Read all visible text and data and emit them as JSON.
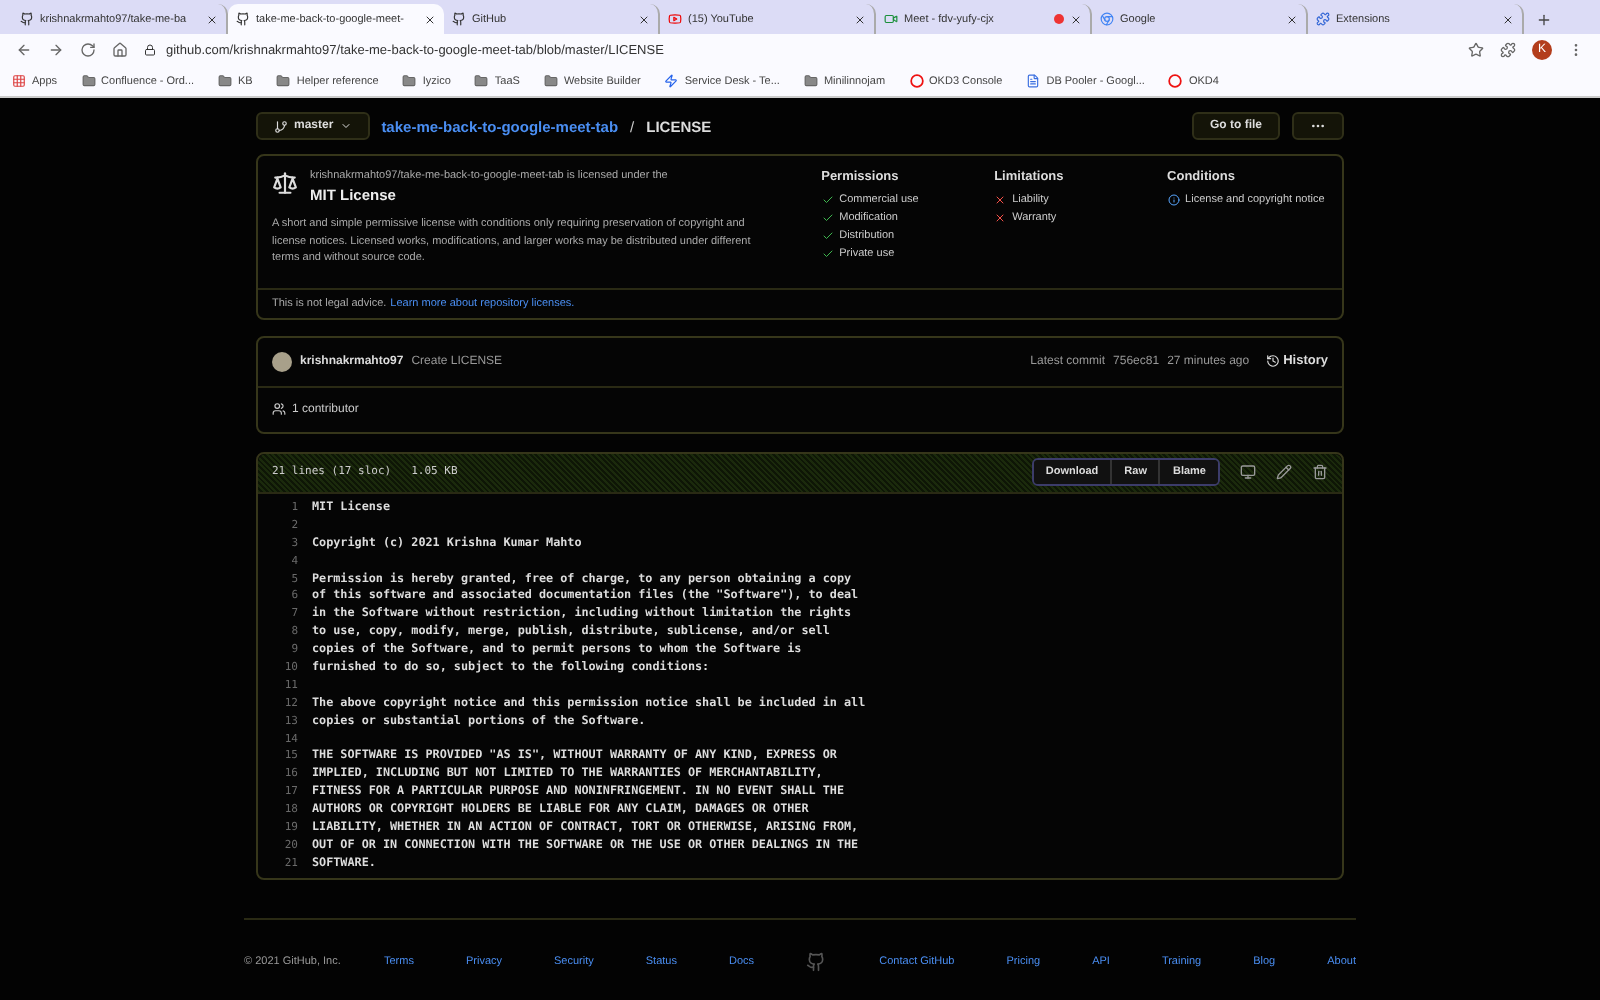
{
  "browser": {
    "tabs": [
      {
        "title": "krishnakrmahto97/take-me-ba",
        "kind": "github",
        "selected": false,
        "recording": false
      },
      {
        "title": "take-me-back-to-google-meet-",
        "kind": "github",
        "selected": true,
        "recording": false
      },
      {
        "title": "GitHub",
        "kind": "github",
        "selected": false,
        "recording": false
      },
      {
        "title": "(15) YouTube",
        "kind": "youtube",
        "selected": false,
        "recording": false
      },
      {
        "title": "Meet - fdv-yufy-cjx",
        "kind": "meet",
        "selected": false,
        "recording": true
      },
      {
        "title": "Google",
        "kind": "google",
        "selected": false,
        "recording": false
      },
      {
        "title": "Extensions",
        "kind": "puzzle",
        "selected": false,
        "recording": false
      }
    ],
    "url": "github.com/krishnakrmahto97/take-me-back-to-google-meet-tab/blob/master/LICENSE",
    "profile": "K",
    "bookmarks": [
      {
        "label": "Apps",
        "kind": "apps"
      },
      {
        "label": "Confluence - Ord...",
        "kind": "folder"
      },
      {
        "label": "KB",
        "kind": "folder"
      },
      {
        "label": "Helper reference",
        "kind": "folder"
      },
      {
        "label": "Iyzico",
        "kind": "folder"
      },
      {
        "label": "TaaS",
        "kind": "folder"
      },
      {
        "label": "Website Builder",
        "kind": "folder"
      },
      {
        "label": "Service Desk - Te...",
        "kind": "jira"
      },
      {
        "label": "Minilinnojam",
        "kind": "folder"
      },
      {
        "label": "OKD3 Console",
        "kind": "ring"
      },
      {
        "label": "DB Pooler - Googl...",
        "kind": "doc"
      },
      {
        "label": "OKD4",
        "kind": "ring"
      }
    ]
  },
  "breadcrumb": {
    "branch": "master",
    "repo": "take-me-back-to-google-meet-tab",
    "separator": "/",
    "file": "LICENSE",
    "buttons": [
      "Go to file"
    ]
  },
  "license": {
    "intro": "krishnakrmahto97/take-me-back-to-google-meet-tab is licensed under the",
    "name": "MIT License",
    "description": "A short and simple permissive license with conditions only requiring preservation of copyright and license notices. Licensed works, modifications, and larger works may be distributed under different terms and without source code.",
    "groups": [
      {
        "title": "Permissions",
        "items": [
          {
            "label": "Commercial use",
            "kind": "permission"
          },
          {
            "label": "Modification",
            "kind": "permission"
          },
          {
            "label": "Distribution",
            "kind": "permission"
          },
          {
            "label": "Private use",
            "kind": "permission"
          }
        ]
      },
      {
        "title": "Limitations",
        "items": [
          {
            "label": "Liability",
            "kind": "limitation"
          },
          {
            "label": "Warranty",
            "kind": "limitation"
          }
        ]
      },
      {
        "title": "Conditions",
        "items": [
          {
            "label": "License and copyright notice",
            "kind": "condition"
          }
        ]
      }
    ],
    "notice": "This is not legal advice.",
    "notice_link": "Learn more about repository licenses."
  },
  "commit": {
    "author": "krishnakrmahto97",
    "message": "Create LICENSE",
    "latest": "Latest commit",
    "sha": "756ec81",
    "time": "27 minutes ago",
    "history": "History",
    "contributors": "1 contributor"
  },
  "file": {
    "lines_info": "21 lines (17 sloc)",
    "size": "1.05 KB",
    "actions": [
      "Download",
      "Raw",
      "Blame"
    ],
    "lines": [
      {
        "number": "1",
        "text": "MIT License"
      },
      {
        "number": "2"
      },
      {
        "number": "3",
        "text": "Copyright (c) 2021 Krishna Kumar Mahto"
      },
      {
        "number": "4"
      },
      {
        "number": "5",
        "text": "Permission is hereby granted, free of charge, to any person obtaining a copy"
      },
      {
        "number": "6",
        "text": "of this software and associated documentation files (the \"Software\"), to deal"
      },
      {
        "number": "7",
        "text": "in the Software without restriction, including without limitation the rights"
      },
      {
        "number": "8",
        "text": "to use, copy, modify, merge, publish, distribute, sublicense, and/or sell"
      },
      {
        "number": "9",
        "text": "copies of the Software, and to permit persons to whom the Software is"
      },
      {
        "number": "10",
        "text": "furnished to do so, subject to the following conditions:"
      },
      {
        "number": "11"
      },
      {
        "number": "12",
        "text": "The above copyright notice and this permission notice shall be included in all"
      },
      {
        "number": "13",
        "text": "copies or substantial portions of the Software."
      },
      {
        "number": "14"
      },
      {
        "number": "15",
        "text": "THE SOFTWARE IS PROVIDED \"AS IS\", WITHOUT WARRANTY OF ANY KIND, EXPRESS OR"
      },
      {
        "number": "16",
        "text": "IMPLIED, INCLUDING BUT NOT LIMITED TO THE WARRANTIES OF MERCHANTABILITY,"
      },
      {
        "number": "17",
        "text": "FITNESS FOR A PARTICULAR PURPOSE AND NONINFRINGEMENT. IN NO EVENT SHALL THE"
      },
      {
        "number": "18",
        "text": "AUTHORS OR COPYRIGHT HOLDERS BE LIABLE FOR ANY CLAIM, DAMAGES OR OTHER"
      },
      {
        "number": "19",
        "text": "LIABILITY, WHETHER IN AN ACTION OF CONTRACT, TORT OR OTHERWISE, ARISING FROM,"
      },
      {
        "number": "20",
        "text": "OUT OF OR IN CONNECTION WITH THE SOFTWARE OR THE USE OR OTHER DEALINGS IN THE"
      },
      {
        "number": "21",
        "text": "SOFTWARE."
      }
    ]
  },
  "footer": {
    "copyright": "© 2021 GitHub, Inc.",
    "left_links": [
      "Terms",
      "Privacy",
      "Security",
      "Status",
      "Docs"
    ],
    "right_links": [
      "Contact GitHub",
      "Pricing",
      "API",
      "Training",
      "Blog",
      "About"
    ]
  }
}
